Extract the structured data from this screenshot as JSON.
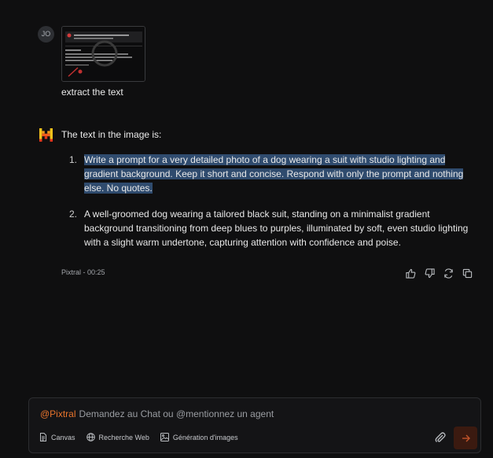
{
  "user_turn": {
    "avatar_initials": "JO",
    "message": "extract  the text"
  },
  "assistant_turn": {
    "intro": "The text in the image is:",
    "items": [
      {
        "number": "1.",
        "text": "Write a prompt for a very detailed photo of a dog wearing a suit with studio lighting and gradient background. Keep it short and concise. Respond with only the prompt and nothing else. No quotes.",
        "selected": true
      },
      {
        "number": "2.",
        "text": "A well-groomed dog wearing a tailored black suit, standing on a minimalist gradient background transitioning from deep blues to purples, illuminated by soft, even studio lighting with a slight warm undertone, capturing attention with confidence and poise.",
        "selected": false
      }
    ],
    "meta": "Pixtral - 00:25",
    "actions": [
      "thumbs-up-icon",
      "thumbs-down-icon",
      "regenerate-icon",
      "copy-icon"
    ]
  },
  "composer": {
    "mention": "@Pixtral",
    "placeholder": "Demandez au Chat ou @mentionnez un agent",
    "tools": [
      {
        "label": "Canvas",
        "icon": "document-icon"
      },
      {
        "label": "Recherche Web",
        "icon": "globe-icon"
      },
      {
        "label": "Génération d'images",
        "icon": "image-icon"
      }
    ],
    "attach_icon": "paperclip-icon",
    "send_icon": "arrow-right-icon"
  },
  "colors": {
    "background": "#0f0f10",
    "accent": "#e8742c",
    "selection": "#2f4b6e",
    "send_bg": "#3b1a10"
  }
}
